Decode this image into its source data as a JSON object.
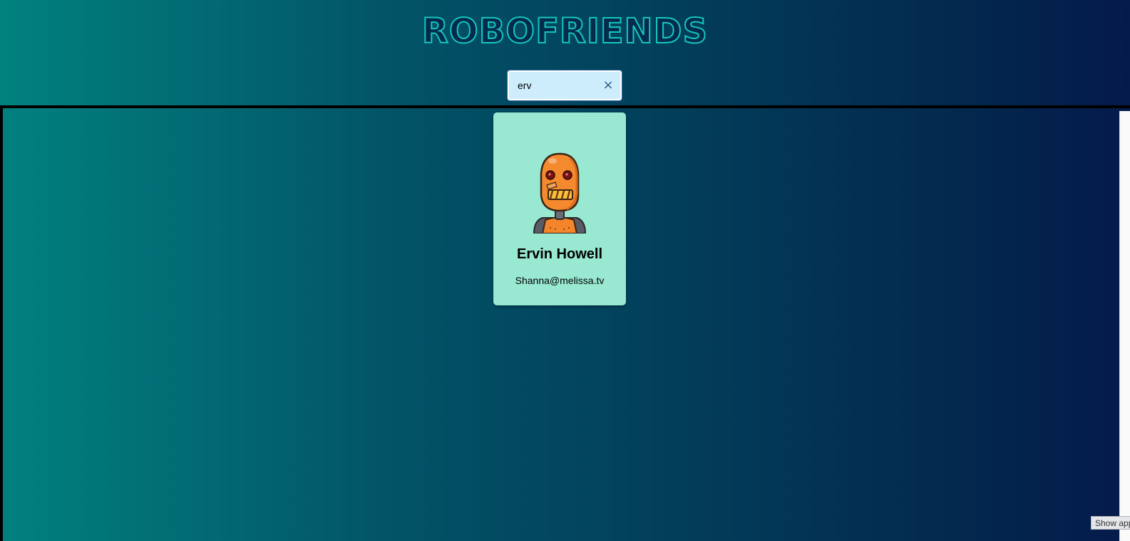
{
  "header": {
    "title": "ROBOFRIENDS"
  },
  "search": {
    "value": "erv",
    "clear_label": "×"
  },
  "robots": [
    {
      "name": "Ervin Howell",
      "email": "Shanna@melissa.tv",
      "avatar_icon": "orange-robot-avatar"
    }
  ],
  "overlay": {
    "show_apps_label": "Show app"
  },
  "colors": {
    "card_bg": "#98e8d2",
    "title_color": "#13c7be",
    "search_bg": "#cdedfd",
    "gradient_left": "#01817f",
    "gradient_right": "#041a4b"
  }
}
